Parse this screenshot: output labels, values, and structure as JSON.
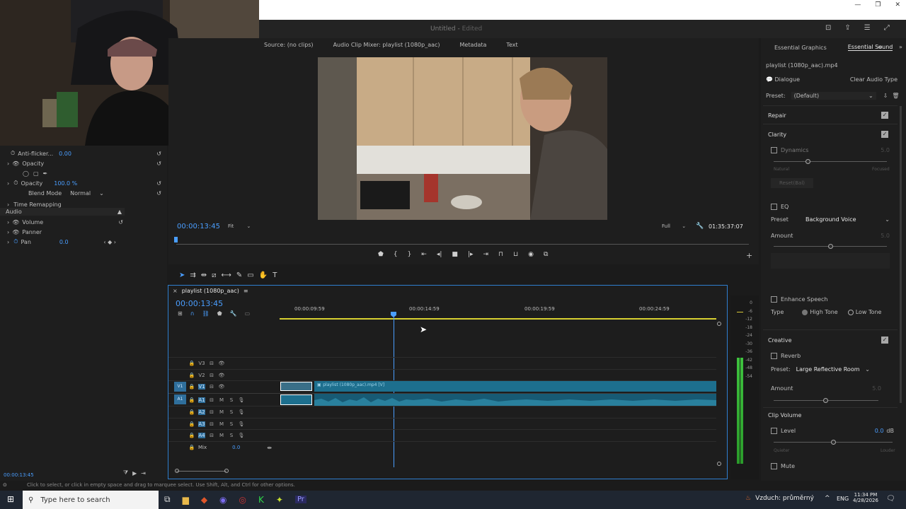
{
  "window": {
    "title": "Untitled",
    "title_status": "Edited"
  },
  "program_tabs": [
    "Source: (no clips)",
    "Audio Clip Mixer: playlist (1080p_aac)",
    "Metadata",
    "Text"
  ],
  "effect_controls": {
    "antiflicker_label": "Anti-flicker...",
    "antiflicker_value": "0.00",
    "opacity_label": "Opacity",
    "opacity_sub_label": "Opacity",
    "opacity_value": "100.0 %",
    "blend_label": "Blend Mode",
    "blend_value": "Normal",
    "time_remap_label": "Time Remapping",
    "audio_header": "Audio",
    "volume_label": "Volume",
    "panner_label": "Panner",
    "pan_label": "Pan",
    "pan_value": "0.0",
    "bottom_timecode": "00:00:13:45"
  },
  "monitor": {
    "timecode": "00:00:13:45",
    "fit": "Fit",
    "resolution": "Full",
    "duration": "01:35:37:07"
  },
  "tools": [
    "select",
    "track-select",
    "ripple",
    "razor",
    "slip",
    "pen",
    "rect",
    "hand",
    "type"
  ],
  "timeline": {
    "sequence_name": "playlist (1080p_aac)",
    "timecode": "00:00:13:45",
    "ruler_labels": [
      "00:00:09:59",
      "00:00:14:59",
      "00:00:19:59",
      "00:00:24:59"
    ],
    "video_tracks": [
      "V3",
      "V2",
      "V1"
    ],
    "audio_tracks": [
      "A1",
      "A2",
      "A3",
      "A4"
    ],
    "source_v": "V1",
    "source_a": "A1",
    "mix_label": "Mix",
    "mix_value": "0.0",
    "clip_video_label": "playlist (1080p_aac).mp4 [V]"
  },
  "meter_scale": [
    "0",
    "-6",
    "-12",
    "-18",
    "-24",
    "-30",
    "-36",
    "-42",
    "-48",
    "-54"
  ],
  "essential_sound": {
    "tabs": [
      "Essential Graphics",
      "Essential Sound"
    ],
    "clip_name": "playlist (1080p_aac).mp4",
    "type": "Dialogue",
    "clear_button": "Clear Audio Type",
    "preset_label": "Preset:",
    "preset_value": "(Default)",
    "repair": "Repair",
    "clarity": "Clarity",
    "dynamics": "Dynamics",
    "dyn_low": "Natural",
    "dyn_high": "Focused",
    "reset_button": "Reset(Bal)",
    "eq": "EQ",
    "eq_preset_label": "Preset",
    "eq_preset_value": "Background Voice",
    "amount_label": "Amount",
    "enhance_speech": "Enhance Speech",
    "type_label": "Type",
    "high_tone": "High Tone",
    "low_tone": "Low Tone",
    "creative": "Creative",
    "reverb": "Reverb",
    "reverb_preset_label": "Preset:",
    "reverb_preset_value": "Large Reflective Room",
    "reverb_amount_label": "Amount",
    "clip_volume": "Clip Volume",
    "level": "Level",
    "level_value": "0.0",
    "level_unit": "dB",
    "quieter": "Quieter",
    "louder": "Louder",
    "mute": "Mute",
    "dyn_value": "5.0",
    "eq_amount_value": "5.0",
    "reverb_amount_value": "5.0"
  },
  "status_bar": "Click to select, or click in empty space and drag to marquee select. Use Shift, Alt, and Ctrl for other options.",
  "taskbar": {
    "search_placeholder": "Type here to search",
    "weather": "Vzduch: průměrný",
    "lang": "ENG",
    "time": "11:34 PM",
    "date": "4/28/2026"
  },
  "colors": {
    "accent": "#4a9eff",
    "clip": "#1d6f8e",
    "playhead": "#4a9eff",
    "bg": "#1b1b1b"
  }
}
